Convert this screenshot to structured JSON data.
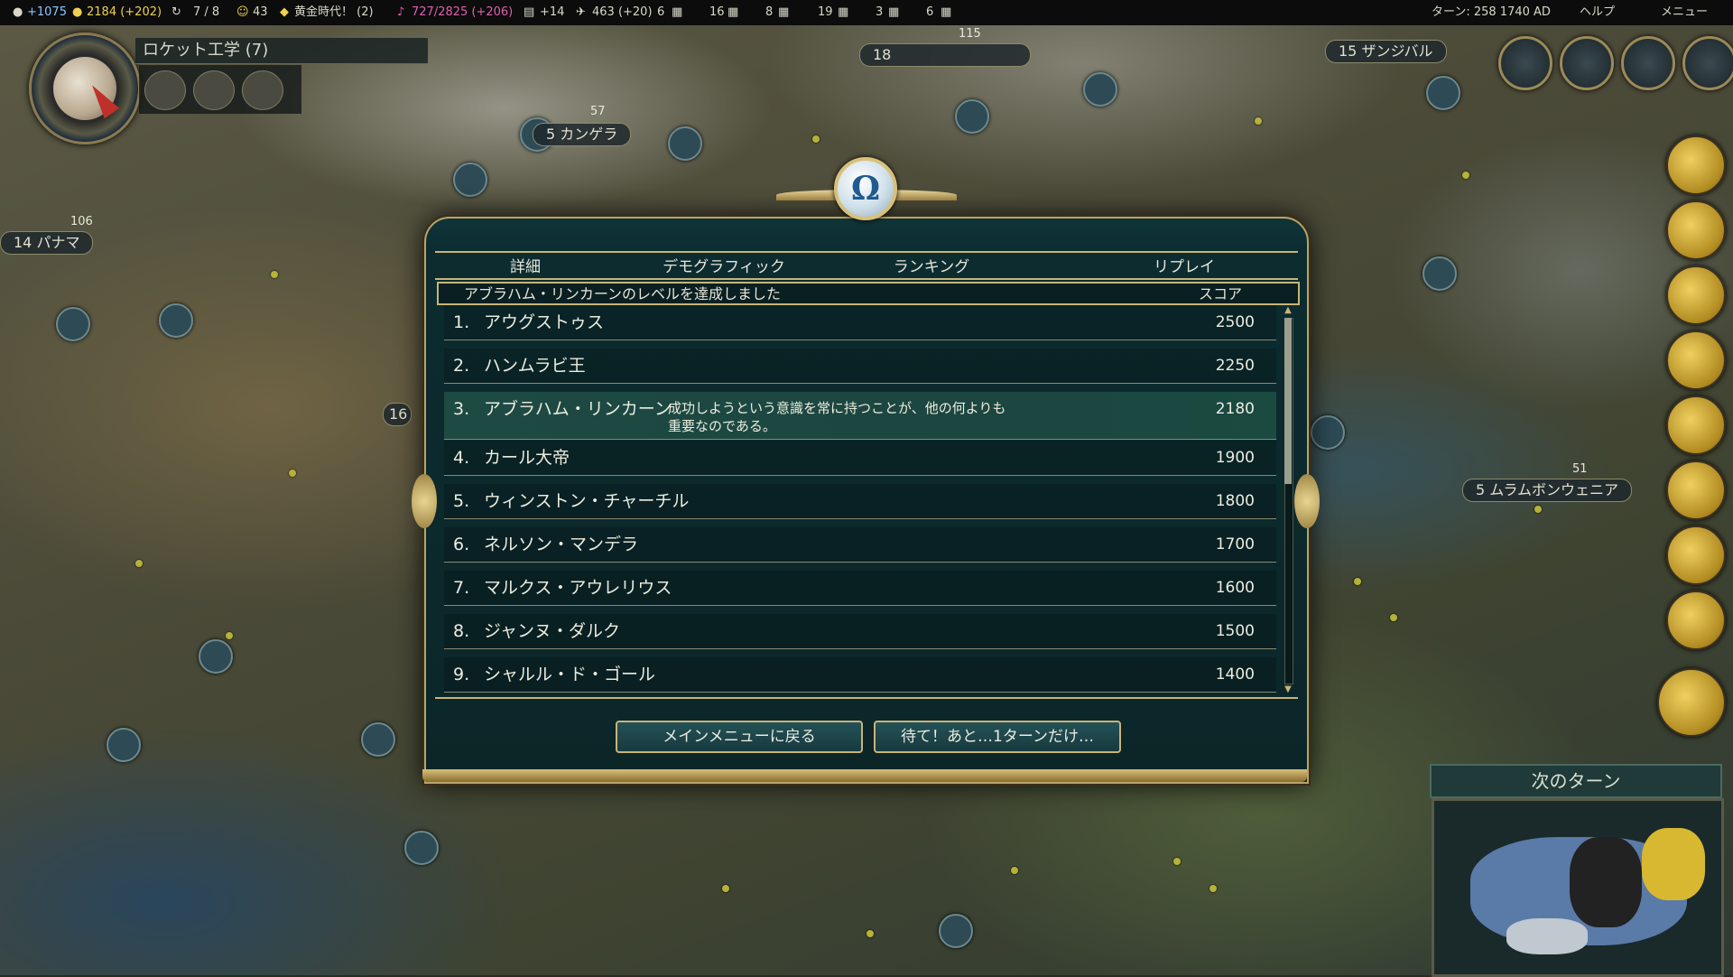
{
  "topbar": {
    "science": "+1075",
    "gold": "2184 (+202)",
    "policies": "7 / 8",
    "happiness": "43",
    "golden_age": "黄金時代！ (2)",
    "culture": "727/2825 (+206)",
    "tourism": "+14",
    "faith": "463 (+20)",
    "res1": "6",
    "res2": "16",
    "res3": "8",
    "res4": "19",
    "res5": "3",
    "res6": "6",
    "turn": "ターン: 258  1740 AD",
    "help": "ヘルプ",
    "menu": "メニュー"
  },
  "research": {
    "name": "ロケット工学 (7)"
  },
  "map_labels": {
    "city1": "カンゲラ",
    "city1_size": "5",
    "city2": "パナマ",
    "city2_size": "14",
    "city3": "ムラムボンウェニア",
    "city3_size": "5",
    "city4": "ザンジバル",
    "city4_size": "15",
    "city5_size": "18",
    "city6_size": "16",
    "def1": "57",
    "def2": "106",
    "def3": "115",
    "def4": "51"
  },
  "dialog": {
    "omega": "Ω",
    "tabs": [
      "詳細",
      "デモグラフィック",
      "ランキング",
      "リプレイ"
    ],
    "caption": "アブラハム・リンカーンのレベルを達成しました",
    "score_header": "スコア",
    "rows": [
      {
        "rank": "1.",
        "name": "アウグストゥス",
        "score": "2500"
      },
      {
        "rank": "2.",
        "name": "ハンムラビ王",
        "score": "2250"
      },
      {
        "rank": "3.",
        "name": "アブラハム・リンカーン",
        "score": "2180",
        "quote_line1": "成功しようという意識を常に持つことが、他の何よりも",
        "quote_line2": "重要なのである。"
      },
      {
        "rank": "4.",
        "name": "カール大帝",
        "score": "1900"
      },
      {
        "rank": "5.",
        "name": "ウィンストン・チャーチル",
        "score": "1800"
      },
      {
        "rank": "6.",
        "name": "ネルソン・マンデラ",
        "score": "1700"
      },
      {
        "rank": "7.",
        "name": "マルクス・アウレリウス",
        "score": "1600"
      },
      {
        "rank": "8.",
        "name": "ジャンヌ・ダルク",
        "score": "1500"
      },
      {
        "rank": "9.",
        "name": "シャルル・ド・ゴール",
        "score": "1400"
      }
    ],
    "main_menu_button": "メインメニューに戻る",
    "one_more_turn_button": "待て！あと…1ターンだけ…"
  },
  "next_turn": "次のターン",
  "colors": {
    "panel": "#0c2c30",
    "gold_trim": "#c8b478",
    "highlight_row": "#1e4a44",
    "button": "#245258"
  }
}
